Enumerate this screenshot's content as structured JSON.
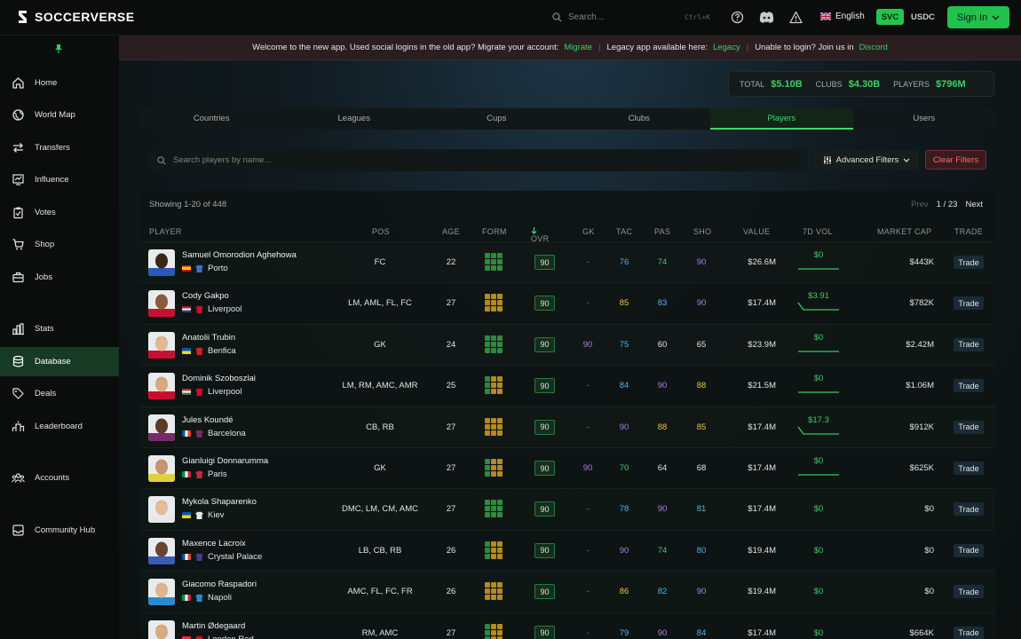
{
  "brand": {
    "name": "SOCCERVERSE"
  },
  "topbar": {
    "search_placeholder": "Search...",
    "shortcut": "Ctrl+K",
    "language": "English",
    "svc": "SVC",
    "usdc": "USDC",
    "signin": "Sign In"
  },
  "sidebar": {
    "items": [
      {
        "label": "Home",
        "icon": "home-icon"
      },
      {
        "label": "World Map",
        "icon": "globe-icon"
      },
      {
        "label": "Transfers",
        "icon": "swap-icon"
      },
      {
        "label": "Influence",
        "icon": "chart-icon"
      },
      {
        "label": "Votes",
        "icon": "clipboard-icon"
      },
      {
        "label": "Shop",
        "icon": "cart-icon"
      },
      {
        "label": "Jobs",
        "icon": "briefcase-icon"
      },
      {
        "label": "Stats",
        "icon": "bars-icon"
      },
      {
        "label": "Database",
        "icon": "database-icon"
      },
      {
        "label": "Deals",
        "icon": "tag-icon"
      },
      {
        "label": "Leaderboard",
        "icon": "podium-icon"
      },
      {
        "label": "Accounts",
        "icon": "users-icon"
      },
      {
        "label": "Community Hub",
        "icon": "inbox-icon"
      }
    ]
  },
  "banner": {
    "text1": "Welcome to the new app. Used social logins in the old app? Migrate your account:",
    "link1": "Migrate",
    "text2": "Legacy app available here:",
    "link2": "Legacy",
    "text3": "Unable to login? Join us in",
    "link3": "Discord"
  },
  "totals": {
    "total_label": "TOTAL",
    "total_value": "5.10B",
    "clubs_label": "CLUBS",
    "clubs_value": "4.30B",
    "players_label": "PLAYERS",
    "players_value": "796M"
  },
  "tabs": [
    "Countries",
    "Leagues",
    "Cups",
    "Clubs",
    "Players",
    "Users"
  ],
  "filters": {
    "search_placeholder": "Search players by name...",
    "advanced": "Advanced Filters",
    "clear": "Clear Filters"
  },
  "table": {
    "showing": "Showing 1-20 of 448",
    "pager": {
      "prev": "Prev",
      "page": "1 / 23",
      "next": "Next"
    },
    "headers": {
      "player": "PLAYER",
      "pos": "POS",
      "age": "AGE",
      "form": "FORM",
      "ovr": "OVR",
      "gk": "GK",
      "tac": "TAC",
      "pas": "PAS",
      "sho": "SHO",
      "value": "VALUE",
      "vol": "7D VOL",
      "cap": "MARKET CAP",
      "trade": "TRADE"
    },
    "trade_label": "Trade",
    "rows": [
      {
        "name": "Samuel Omorodion Aghehowa",
        "club": "Porto",
        "pos": "FC",
        "age": "22",
        "ovr": "90",
        "gk": "-",
        "tac": "76",
        "pas": "74",
        "sho": "90",
        "value": "26.6M",
        "vol": "0",
        "cap": "443K"
      },
      {
        "name": "Cody Gakpo",
        "club": "Liverpool",
        "pos": "LM, AML, FL, FC",
        "age": "27",
        "ovr": "90",
        "gk": "-",
        "tac": "85",
        "pas": "83",
        "sho": "90",
        "value": "17.4M",
        "vol": "3.91",
        "cap": "782K"
      },
      {
        "name": "Anatolii Trubin",
        "club": "Benfica",
        "pos": "GK",
        "age": "24",
        "ovr": "90",
        "gk": "90",
        "tac": "75",
        "pas": "60",
        "sho": "65",
        "value": "23.9M",
        "vol": "0",
        "cap": "2.42M"
      },
      {
        "name": "Dominik Szoboszlai",
        "club": "Liverpool",
        "pos": "LM, RM, AMC, AMR",
        "age": "25",
        "ovr": "90",
        "gk": "-",
        "tac": "84",
        "pas": "90",
        "sho": "88",
        "value": "21.5M",
        "vol": "0",
        "cap": "1.06M"
      },
      {
        "name": "Jules Koundé",
        "club": "Barcelona",
        "pos": "CB, RB",
        "age": "27",
        "ovr": "90",
        "gk": "-",
        "tac": "90",
        "pas": "88",
        "sho": "85",
        "value": "17.4M",
        "vol": "17.3",
        "cap": "912K"
      },
      {
        "name": "Gianluigi Donnarumma",
        "club": "Paris",
        "pos": "GK",
        "age": "27",
        "ovr": "90",
        "gk": "90",
        "tac": "70",
        "pas": "64",
        "sho": "68",
        "value": "17.4M",
        "vol": "0",
        "cap": "625K"
      },
      {
        "name": "Mykola Shaparenko",
        "club": "Kiev",
        "pos": "DMC, LM, CM, AMC",
        "age": "27",
        "ovr": "90",
        "gk": "-",
        "tac": "78",
        "pas": "90",
        "sho": "81",
        "value": "17.4M",
        "vol": "0",
        "cap": "0"
      },
      {
        "name": "Maxence Lacroix",
        "club": "Crystal Palace",
        "pos": "LB, CB, RB",
        "age": "26",
        "ovr": "90",
        "gk": "-",
        "tac": "90",
        "pas": "74",
        "sho": "80",
        "value": "19.4M",
        "vol": "0",
        "cap": "0"
      },
      {
        "name": "Giacomo Raspadori",
        "club": "Napoli",
        "pos": "AMC, FL, FC, FR",
        "age": "26",
        "ovr": "90",
        "gk": "-",
        "tac": "86",
        "pas": "82",
        "sho": "90",
        "value": "19.4M",
        "vol": "0",
        "cap": "0"
      },
      {
        "name": "Martin Ødegaard",
        "club": "London Red",
        "pos": "RM, AMC",
        "age": "27",
        "ovr": "90",
        "gk": "-",
        "tac": "79",
        "pas": "90",
        "sho": "84",
        "value": "17.4M",
        "vol": "0",
        "cap": "664K"
      }
    ]
  }
}
